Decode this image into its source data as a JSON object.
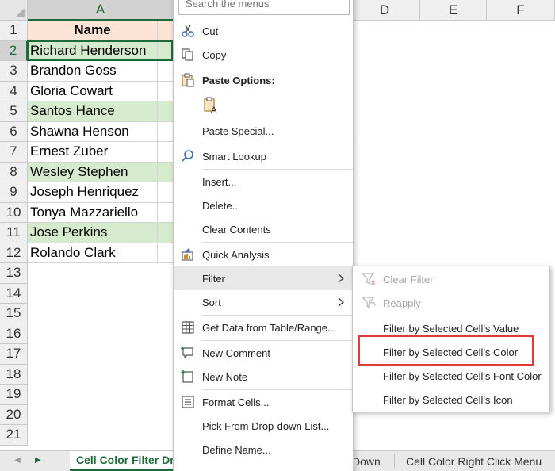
{
  "columns": {
    "A": "A",
    "D": "D",
    "E": "E",
    "F": "F"
  },
  "rows": [
    "1",
    "2",
    "3",
    "4",
    "5",
    "6",
    "7",
    "8",
    "9",
    "10",
    "11",
    "12",
    "13",
    "14",
    "15",
    "16",
    "17",
    "18",
    "19",
    "20",
    "21"
  ],
  "cells": [
    {
      "row": "1",
      "value": "Name",
      "fill": "header"
    },
    {
      "row": "2",
      "value": "Richard Henderson",
      "fill": "green"
    },
    {
      "row": "3",
      "value": "Brandon Goss",
      "fill": "none"
    },
    {
      "row": "4",
      "value": "Gloria Cowart",
      "fill": "none"
    },
    {
      "row": "5",
      "value": "Santos Hance",
      "fill": "green"
    },
    {
      "row": "6",
      "value": "Shawna Henson",
      "fill": "none"
    },
    {
      "row": "7",
      "value": "Ernest Zuber",
      "fill": "none"
    },
    {
      "row": "8",
      "value": "Wesley Stephen",
      "fill": "green"
    },
    {
      "row": "9",
      "value": "Joseph Henriquez",
      "fill": "none"
    },
    {
      "row": "10",
      "value": "Tonya Mazzariello",
      "fill": "none"
    },
    {
      "row": "11",
      "value": "Jose Perkins",
      "fill": "green"
    },
    {
      "row": "12",
      "value": "Rolando Clark",
      "fill": "none"
    }
  ],
  "colors": {
    "header_fill": "#fbe3d6",
    "green_fill": "#d6ebcd",
    "excel_green": "#1e6b3a",
    "highlight_red": "#e03a3a"
  },
  "context_menu": {
    "search_placeholder": "Search the menus",
    "cut": "Cut",
    "copy": "Copy",
    "paste_options": "Paste Options:",
    "paste_special": "Paste Special...",
    "smart_lookup": "Smart Lookup",
    "insert": "Insert...",
    "delete": "Delete...",
    "clear_contents": "Clear Contents",
    "quick_analysis": "Quick Analysis",
    "filter": "Filter",
    "sort": "Sort",
    "get_data": "Get Data from Table/Range...",
    "new_comment": "New Comment",
    "new_note": "New Note",
    "format_cells": "Format Cells...",
    "pick_dropdown": "Pick From Drop-down List...",
    "define_name": "Define Name..."
  },
  "filter_submenu": {
    "clear_filter": "Clear Filter",
    "reapply": "Reapply",
    "by_value": "Filter by Selected Cell's Value",
    "by_color": "Filter by Selected Cell's Color",
    "by_font_color": "Filter by Selected Cell's Font Color",
    "by_icon": "Filter by Selected Cell's Icon"
  },
  "sheet_tabs": {
    "active": "Cell Color Filter Dr",
    "partial": "Down",
    "other": "Cell Color Right Click Menu"
  },
  "icons": {
    "cut": "scissors-icon",
    "copy": "copy-icon",
    "paste": "clipboard-icon",
    "smart_lookup": "magnifier-icon",
    "quick_analysis": "chart-icon",
    "get_data": "table-icon",
    "new_comment": "comment-icon",
    "new_note": "note-icon",
    "format_cells": "format-cells-icon"
  }
}
